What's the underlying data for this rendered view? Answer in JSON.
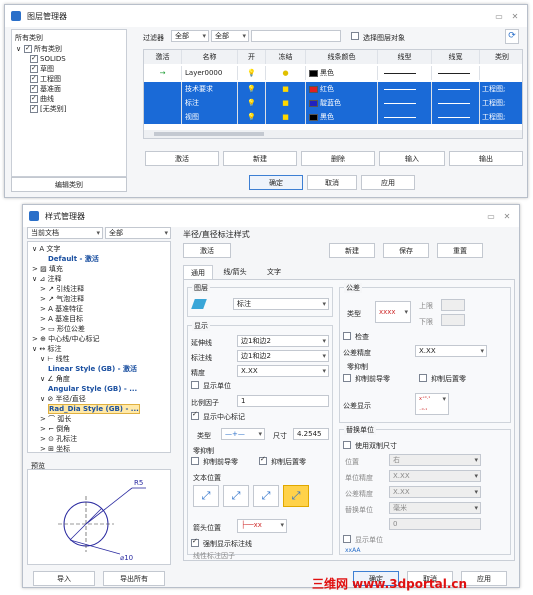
{
  "layer_manager": {
    "title": "图层管理器",
    "category_header": "所有类别",
    "tree": [
      "所有类别",
      "SOLIDS",
      "草图",
      "工程图",
      "基准面",
      "曲线",
      "[无类别]"
    ],
    "edit_category": "编辑类别",
    "filter_label": "过滤器",
    "filter1": "全部",
    "filter2": "全部",
    "select_layer_object": "选择图层对象",
    "columns": [
      "激活",
      "名称",
      "开",
      "冻结",
      "线条颜色",
      "线型",
      "线宽",
      "类别"
    ],
    "rows": [
      {
        "active": "→",
        "name": "Layer0000",
        "color_name": "黑色",
        "color": "#000000",
        "category": ""
      },
      {
        "active": "",
        "name": "技术要求",
        "color_name": "红色",
        "color": "#e02020",
        "category": "工程图;"
      },
      {
        "active": "",
        "name": "标注",
        "color_name": "靛蓝色",
        "color": "#2020c0",
        "category": "工程图;"
      },
      {
        "active": "",
        "name": "视图",
        "color_name": "黑色",
        "color": "#000000",
        "category": "工程图;"
      }
    ],
    "buttons": [
      "激活",
      "新建",
      "删除",
      "输入",
      "输出"
    ],
    "ok": "确定",
    "cancel": "取消",
    "apply": "应用"
  },
  "style_manager": {
    "title": "样式管理器",
    "doc_filter": "当前文档",
    "all_filter": "全部",
    "tree": [
      {
        "t": "∨ A 文字",
        "d": 0,
        "b": false
      },
      {
        "t": "Default - 激活",
        "d": 2,
        "b": true
      },
      {
        "t": "> ▨ 填充",
        "d": 0,
        "b": false
      },
      {
        "t": "∨ ⊿ 注释",
        "d": 0,
        "b": false
      },
      {
        "t": "> ↗ 引线注释",
        "d": 1,
        "b": false
      },
      {
        "t": "> ↗ 气泡注释",
        "d": 1,
        "b": false
      },
      {
        "t": "> A 基准特征",
        "d": 1,
        "b": false
      },
      {
        "t": "> A 基准目标",
        "d": 1,
        "b": false
      },
      {
        "t": "> ▭ 形位公差",
        "d": 1,
        "b": false
      },
      {
        "t": "> ⊕ 中心线/中心标记",
        "d": 0,
        "b": false
      },
      {
        "t": "∨ ↔ 标注",
        "d": 0,
        "b": false
      },
      {
        "t": "∨ ⊢ 线性",
        "d": 1,
        "b": false
      },
      {
        "t": "Linear Style (GB) - 激活",
        "d": 2,
        "b": true
      },
      {
        "t": "∨ ∠ 角度",
        "d": 1,
        "b": false
      },
      {
        "t": "Angular Style (GB) - ...",
        "d": 2,
        "b": true
      },
      {
        "t": "∨ ⊘ 半径/直径",
        "d": 1,
        "b": false
      },
      {
        "t": "Rad_Dia Style (GB) - ...",
        "d": 2,
        "b": true,
        "sel": true
      },
      {
        "t": "> ⌒ 弧长",
        "d": 1,
        "b": false
      },
      {
        "t": "> ⌐ 倒角",
        "d": 1,
        "b": false
      },
      {
        "t": "> ⊙ 孔标注",
        "d": 1,
        "b": false
      },
      {
        "t": "> ⊞ 坐标",
        "d": 1,
        "b": false
      }
    ],
    "preview_label": "预览",
    "preview_r": "R5",
    "preview_d": "⌀10",
    "import": "导入",
    "export_all": "导出所有",
    "panel_title": "半径/直径标注样式",
    "activate": "激活",
    "new": "新建",
    "save": "保存",
    "reset": "重置",
    "tabs": [
      "通用",
      "线/箭头",
      "文字"
    ],
    "layer_group": "图层",
    "layer_value": "标注",
    "display_group": "显示",
    "ext_line": "延伸线",
    "ext_value": "边1和边2",
    "dim_line": "标注线",
    "dim_value": "边1和边2",
    "precision": "精度",
    "prec_value": "X.XX",
    "show_unit": "显示单位",
    "scale": "比例因子",
    "scale_value": "1",
    "show_center": "显示中心标记",
    "type": "类型",
    "size": "尺寸",
    "size_value": "4.2545",
    "zero_suppress": "零抑制",
    "sup_lead": "抑制前导零",
    "sup_trail": "抑制后置零",
    "text_pos": "文本位置",
    "arrow_pos": "箭头位置",
    "force_show": "强制显示标注线",
    "line_scale": "线性标注因子",
    "tol_group": "公差",
    "tol_type": "类型",
    "tol_value": "xxxx",
    "upper": "上限",
    "lower": "下限",
    "check": "检查",
    "tol_prec": "公差精度",
    "tol_prec_value": "X.XX",
    "zero2": "零抑制",
    "sup_lead2": "抑制前导零",
    "sup_trail2": "抑制后置零",
    "tol_display": "公差显示",
    "alt_group": "替换单位",
    "dual": "使用双制尺寸",
    "position": "位置",
    "pos_value": "右",
    "unit_prec": "单位精度",
    "unit_prec_value": "X.XX",
    "tol_prec2": "公差精度",
    "tol_prec2_value": "X.XX",
    "alt_unit": "替换单位",
    "alt_unit_value": "毫米",
    "alt_num": "0",
    "show_unit2": "显示单位",
    "ok": "确定",
    "cancel": "取消",
    "apply": "应用"
  },
  "watermark": "三维网 www.3dportal.cn"
}
